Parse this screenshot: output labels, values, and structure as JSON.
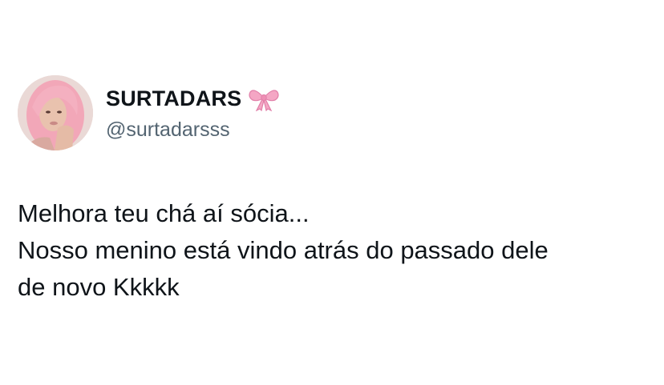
{
  "tweet": {
    "author": {
      "display_name": "SURTADARS",
      "handle": "@surtadarsss",
      "avatar_icon": "profile-photo-pink-hair",
      "badge_icon": "pink-bow-emoji"
    },
    "text_lines": [
      "Melhora teu chá aí sócia...",
      "Nosso menino está vindo atrás do passado dele",
      "de novo Kkkkk"
    ]
  },
  "colors": {
    "text": "#0f1419",
    "secondary_text": "#536471",
    "background": "#ffffff",
    "bow": "#f4a6c4"
  }
}
